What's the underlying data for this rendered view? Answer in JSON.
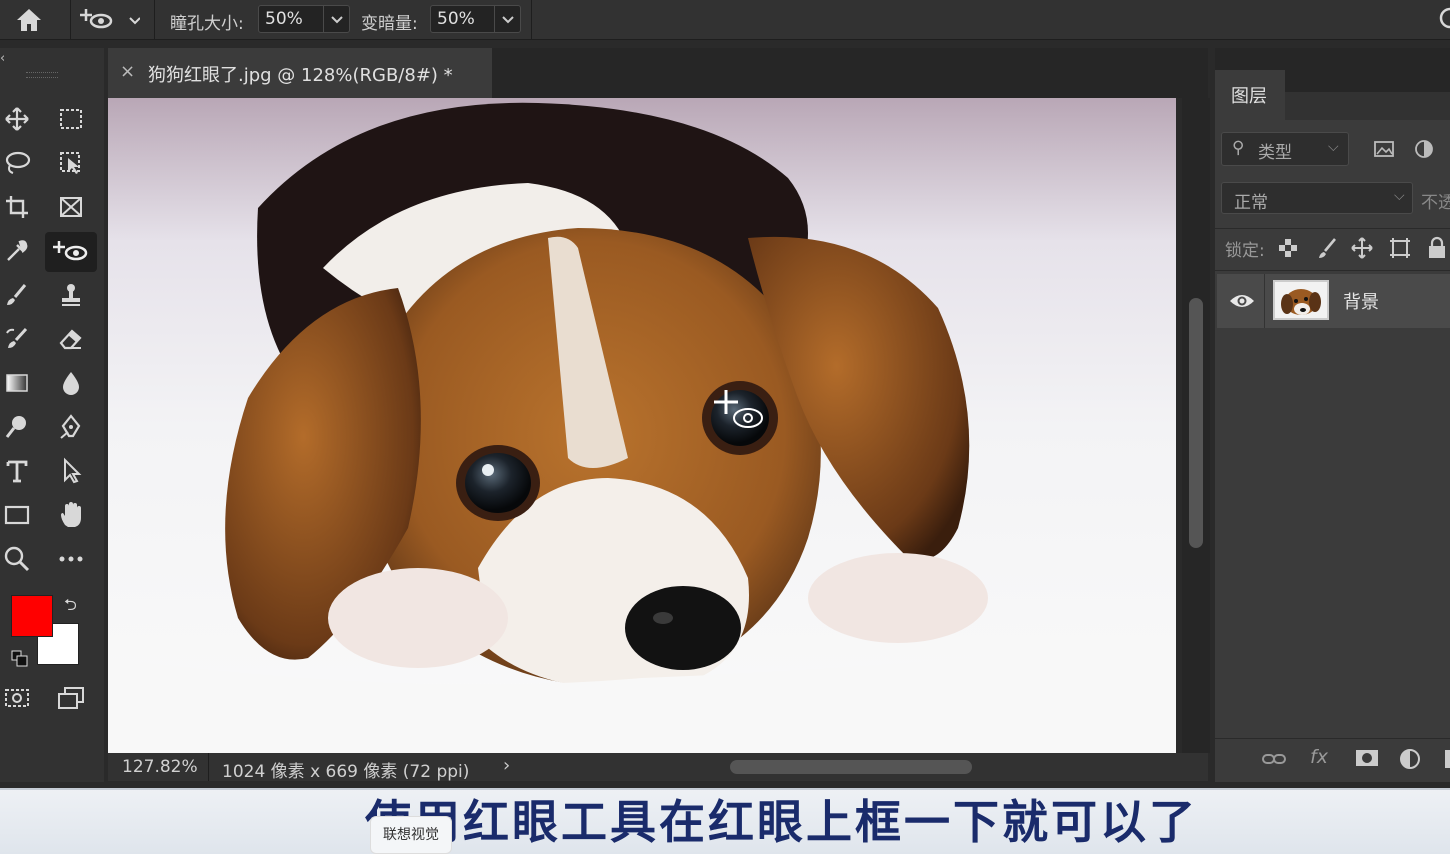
{
  "options_bar": {
    "pupil_size_label": "瞳孔大小:",
    "pupil_size_value": "50%",
    "darken_label": "变暗量:",
    "darken_value": "50%"
  },
  "document": {
    "tab_title": "狗狗红眼了.jpg @ 128%(RGB/8#) *",
    "zoom": "127.82%",
    "doc_info": "1024 像素 x 669 像素 (72 ppi)"
  },
  "layers_panel": {
    "tab": "图层",
    "filter_label": "类型",
    "blend_mode": "正常",
    "opacity_label": "不透",
    "lock_label": "锁定:",
    "layers": [
      {
        "name": "背景"
      }
    ]
  },
  "colors": {
    "foreground": "#ff0000",
    "background": "#ffffff"
  },
  "caption": {
    "subtitle": "使用红眼工具在红眼上框一下就可以了",
    "watermark": "联想视觉"
  },
  "icons": [
    "home-icon",
    "red-eye-tool-icon",
    "move-icon",
    "marquee-icon",
    "lasso-icon",
    "object-select-icon",
    "crop-icon",
    "frame-icon",
    "eyedropper-icon",
    "brush-icon",
    "stamp-icon",
    "history-brush-icon",
    "eraser-icon",
    "gradient-icon",
    "blur-icon",
    "dodge-icon",
    "pen-icon",
    "type-icon",
    "path-select-icon",
    "rectangle-icon",
    "hand-icon",
    "zoom-icon",
    "more-icon",
    "eye-icon",
    "link-icon",
    "fx-icon",
    "mask-icon",
    "adjustment-icon"
  ]
}
